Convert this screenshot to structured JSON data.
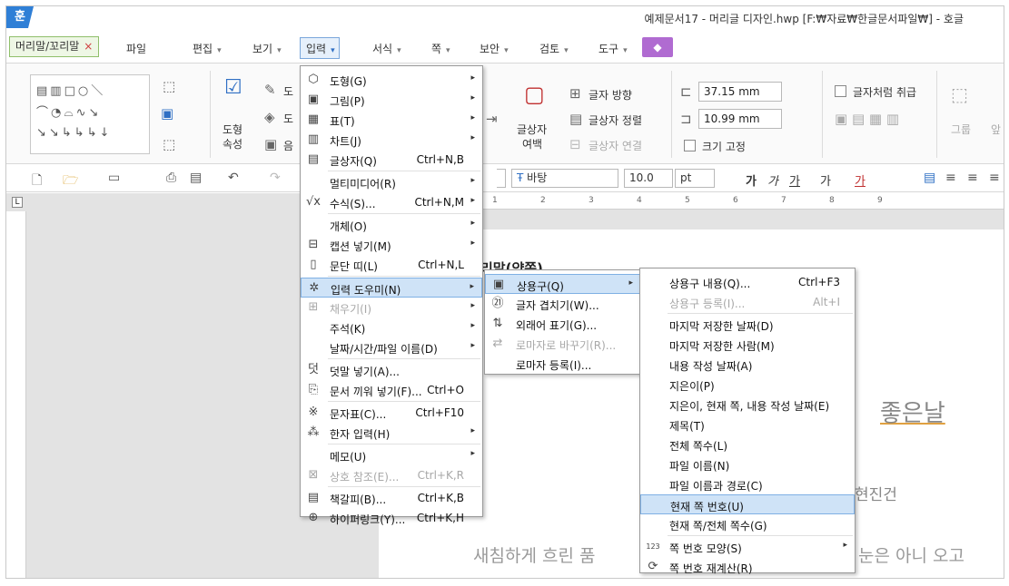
{
  "window": {
    "logo": "훈",
    "title": "예제문서17 - 머리글 디자인.hwp [F:₩자료₩한글문서파일₩] - 호글"
  },
  "tabs": {
    "doc_tab": "머리말/꼬리말",
    "doc_tab_close": "×",
    "menus": [
      "파일",
      "편집",
      "보기",
      "입력",
      "서식",
      "쪽",
      "보안",
      "검토",
      "도구"
    ],
    "active": "입력"
  },
  "ribbon": {
    "shape_props_1": "도형",
    "shape_props_2": "속성",
    "shape_cut_1": "도",
    "shape_cut_2": "도",
    "shape_cut_3": "음",
    "textbox_1": "글상자",
    "textbox_2": "여백",
    "text_direction": "글자 방향",
    "text_align": "글상자 정렬",
    "text_link": "글상자 연결",
    "width_value": "37.15",
    "width_unit": "mm",
    "height_value": "10.99",
    "height_unit": "mm",
    "fixed_size": "크기 고정",
    "treat_as_char": "글자처럼 취급",
    "group": "그룹",
    "more": "앞"
  },
  "toolbar": {
    "font_name": "바탕",
    "font_size": "10.0",
    "font_unit": "pt",
    "bold": "가",
    "italic": "가",
    "underline": "가",
    "strike": "가",
    "color": "가"
  },
  "ruler": {
    "marks": [
      "1",
      "2",
      "3",
      "4",
      "5",
      "6",
      "7",
      "8",
      "9"
    ]
  },
  "document": {
    "line1": "리말(양쪽)",
    "line2": "좋은날",
    "line3": "현진건",
    "line4a": "새침하게 흐린 품",
    "line4b": "눈은 아니 오고"
  },
  "menu_input": [
    {
      "label": "도형(G)",
      "shortcut": "",
      "arrow": true,
      "icon": "shape-icon",
      "glyph": "⬡",
      "disabled": false
    },
    {
      "label": "그림(P)",
      "shortcut": "",
      "arrow": true,
      "icon": "picture-icon",
      "glyph": "▣",
      "disabled": false
    },
    {
      "label": "표(T)",
      "shortcut": "",
      "arrow": true,
      "icon": "table-icon",
      "glyph": "▦",
      "disabled": false
    },
    {
      "label": "차트(J)",
      "shortcut": "",
      "arrow": true,
      "icon": "chart-icon",
      "glyph": "▥",
      "disabled": false
    },
    {
      "label": "글상자(Q)",
      "shortcut": "Ctrl+N,B",
      "arrow": false,
      "icon": "textbox-icon",
      "glyph": "▤",
      "disabled": false
    },
    {
      "label": "멀티미디어(R)",
      "shortcut": "",
      "arrow": true,
      "icon": "",
      "glyph": "",
      "disabled": false
    },
    {
      "label": "수식(S)...",
      "shortcut": "Ctrl+N,M",
      "arrow": true,
      "icon": "formula-icon",
      "glyph": "√x",
      "disabled": false
    },
    {
      "label": "개체(O)",
      "shortcut": "",
      "arrow": true,
      "icon": "",
      "glyph": "",
      "disabled": false
    },
    {
      "label": "캡션 넣기(M)",
      "shortcut": "",
      "arrow": true,
      "icon": "caption-icon",
      "glyph": "⊟",
      "disabled": false
    },
    {
      "label": "문단 띠(L)",
      "shortcut": "Ctrl+N,L",
      "arrow": false,
      "icon": "paragraph-band-icon",
      "glyph": "▯",
      "disabled": false
    },
    {
      "label": "입력 도우미(N)",
      "shortcut": "",
      "arrow": true,
      "icon": "input-helper-icon",
      "glyph": "✲",
      "disabled": false,
      "highlight": true
    },
    {
      "label": "채우기(I)",
      "shortcut": "",
      "arrow": true,
      "icon": "fill-icon",
      "glyph": "⊞",
      "disabled": true
    },
    {
      "label": "주석(K)",
      "shortcut": "",
      "arrow": true,
      "icon": "",
      "glyph": "",
      "disabled": false
    },
    {
      "label": "날짜/시간/파일 이름(D)",
      "shortcut": "",
      "arrow": true,
      "icon": "",
      "glyph": "",
      "disabled": false
    },
    {
      "label": "덧말 넣기(A)...",
      "shortcut": "",
      "arrow": false,
      "icon": "ruby-icon",
      "glyph": "덧",
      "disabled": false
    },
    {
      "label": "문서 끼워 넣기(F)...",
      "shortcut": "Ctrl+O",
      "arrow": false,
      "icon": "insert-doc-icon",
      "glyph": "⎘",
      "disabled": false
    },
    {
      "label": "문자표(C)...",
      "shortcut": "Ctrl+F10",
      "arrow": false,
      "icon": "symbol-icon",
      "glyph": "※",
      "disabled": false
    },
    {
      "label": "한자 입력(H)",
      "shortcut": "",
      "arrow": true,
      "icon": "hanja-icon",
      "glyph": "⁂",
      "disabled": false
    },
    {
      "label": "메모(U)",
      "shortcut": "",
      "arrow": true,
      "icon": "",
      "glyph": "",
      "disabled": false
    },
    {
      "label": "상호 참조(E)...",
      "shortcut": "Ctrl+K,R",
      "arrow": false,
      "icon": "cross-ref-icon",
      "glyph": "⊠",
      "disabled": true
    },
    {
      "label": "책갈피(B)...",
      "shortcut": "Ctrl+K,B",
      "arrow": false,
      "icon": "bookmark-icon",
      "glyph": "▤",
      "disabled": false
    },
    {
      "label": "하이퍼링크(Y)...",
      "shortcut": "Ctrl+K,H",
      "arrow": false,
      "icon": "hyperlink-icon",
      "glyph": "⊕",
      "disabled": false
    }
  ],
  "menu_helper": [
    {
      "label": "상용구(Q)",
      "arrow": true,
      "icon": "phrase-icon",
      "glyph": "▣",
      "disabled": false,
      "highlight": true
    },
    {
      "label": "글자 겹치기(W)...",
      "arrow": false,
      "icon": "overlap-char-icon",
      "glyph": "㉑",
      "disabled": false
    },
    {
      "label": "외래어 표기(G)...",
      "arrow": false,
      "icon": "foreign-word-icon",
      "glyph": "⇅",
      "disabled": false
    },
    {
      "label": "로마자로 바꾸기(R)...",
      "arrow": false,
      "icon": "romanize-icon",
      "glyph": "⇄",
      "disabled": true
    },
    {
      "label": "로마자 등록(I)...",
      "arrow": false,
      "icon": "",
      "glyph": "",
      "disabled": false
    }
  ],
  "menu_phrase": [
    {
      "label": "상용구 내용(Q)...",
      "shortcut": "Ctrl+F3",
      "arrow": false,
      "icon": "",
      "glyph": "",
      "disabled": false
    },
    {
      "label": "상용구 등록(I)...",
      "shortcut": "Alt+I",
      "arrow": false,
      "icon": "",
      "glyph": "",
      "disabled": true
    },
    {
      "label": "마지막 저장한 날짜(D)",
      "shortcut": "",
      "arrow": false,
      "icon": "",
      "glyph": "",
      "disabled": false
    },
    {
      "label": "마지막 저장한 사람(M)",
      "shortcut": "",
      "arrow": false,
      "icon": "",
      "glyph": "",
      "disabled": false
    },
    {
      "label": "내용 작성 날짜(A)",
      "shortcut": "",
      "arrow": false,
      "icon": "",
      "glyph": "",
      "disabled": false
    },
    {
      "label": "지은이(P)",
      "shortcut": "",
      "arrow": false,
      "icon": "",
      "glyph": "",
      "disabled": false
    },
    {
      "label": "지은이, 현재 쪽, 내용 작성 날짜(E)",
      "shortcut": "",
      "arrow": false,
      "icon": "",
      "glyph": "",
      "disabled": false
    },
    {
      "label": "제목(T)",
      "shortcut": "",
      "arrow": false,
      "icon": "",
      "glyph": "",
      "disabled": false
    },
    {
      "label": "전체 쪽수(L)",
      "shortcut": "",
      "arrow": false,
      "icon": "",
      "glyph": "",
      "disabled": false
    },
    {
      "label": "파일 이름(N)",
      "shortcut": "",
      "arrow": false,
      "icon": "",
      "glyph": "",
      "disabled": false
    },
    {
      "label": "파일 이름과 경로(C)",
      "shortcut": "",
      "arrow": false,
      "icon": "",
      "glyph": "",
      "disabled": false
    },
    {
      "label": "현재 쪽 번호(U)",
      "shortcut": "",
      "arrow": false,
      "icon": "",
      "glyph": "",
      "disabled": false,
      "highlight": true
    },
    {
      "label": "현재 쪽/전체 쪽수(G)",
      "shortcut": "",
      "arrow": false,
      "icon": "",
      "glyph": "",
      "disabled": false
    },
    {
      "label": "쪽 번호 모양(S)",
      "shortcut": "",
      "arrow": true,
      "icon": "page-num-shape-icon",
      "glyph": "123",
      "disabled": false
    },
    {
      "label": "쪽 번호 재계산(R)",
      "shortcut": "",
      "arrow": false,
      "icon": "page-num-recalc-icon",
      "glyph": "⟳",
      "disabled": false
    }
  ]
}
